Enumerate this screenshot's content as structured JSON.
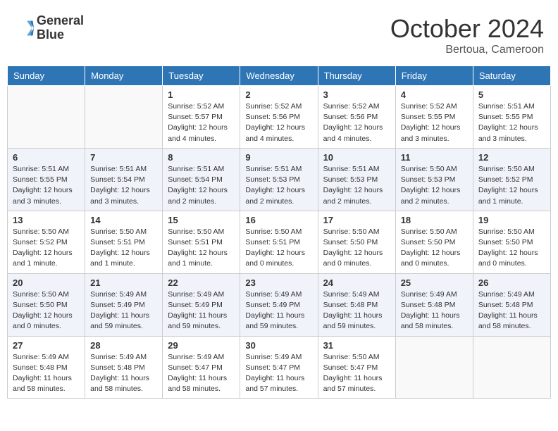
{
  "header": {
    "logo_line1": "General",
    "logo_line2": "Blue",
    "month_title": "October 2024",
    "location": "Bertoua, Cameroon"
  },
  "weekdays": [
    "Sunday",
    "Monday",
    "Tuesday",
    "Wednesday",
    "Thursday",
    "Friday",
    "Saturday"
  ],
  "weeks": [
    [
      {
        "day": "",
        "info": ""
      },
      {
        "day": "",
        "info": ""
      },
      {
        "day": "1",
        "info": "Sunrise: 5:52 AM\nSunset: 5:57 PM\nDaylight: 12 hours\nand 4 minutes."
      },
      {
        "day": "2",
        "info": "Sunrise: 5:52 AM\nSunset: 5:56 PM\nDaylight: 12 hours\nand 4 minutes."
      },
      {
        "day": "3",
        "info": "Sunrise: 5:52 AM\nSunset: 5:56 PM\nDaylight: 12 hours\nand 4 minutes."
      },
      {
        "day": "4",
        "info": "Sunrise: 5:52 AM\nSunset: 5:55 PM\nDaylight: 12 hours\nand 3 minutes."
      },
      {
        "day": "5",
        "info": "Sunrise: 5:51 AM\nSunset: 5:55 PM\nDaylight: 12 hours\nand 3 minutes."
      }
    ],
    [
      {
        "day": "6",
        "info": "Sunrise: 5:51 AM\nSunset: 5:55 PM\nDaylight: 12 hours\nand 3 minutes."
      },
      {
        "day": "7",
        "info": "Sunrise: 5:51 AM\nSunset: 5:54 PM\nDaylight: 12 hours\nand 3 minutes."
      },
      {
        "day": "8",
        "info": "Sunrise: 5:51 AM\nSunset: 5:54 PM\nDaylight: 12 hours\nand 2 minutes."
      },
      {
        "day": "9",
        "info": "Sunrise: 5:51 AM\nSunset: 5:53 PM\nDaylight: 12 hours\nand 2 minutes."
      },
      {
        "day": "10",
        "info": "Sunrise: 5:51 AM\nSunset: 5:53 PM\nDaylight: 12 hours\nand 2 minutes."
      },
      {
        "day": "11",
        "info": "Sunrise: 5:50 AM\nSunset: 5:53 PM\nDaylight: 12 hours\nand 2 minutes."
      },
      {
        "day": "12",
        "info": "Sunrise: 5:50 AM\nSunset: 5:52 PM\nDaylight: 12 hours\nand 1 minute."
      }
    ],
    [
      {
        "day": "13",
        "info": "Sunrise: 5:50 AM\nSunset: 5:52 PM\nDaylight: 12 hours\nand 1 minute."
      },
      {
        "day": "14",
        "info": "Sunrise: 5:50 AM\nSunset: 5:51 PM\nDaylight: 12 hours\nand 1 minute."
      },
      {
        "day": "15",
        "info": "Sunrise: 5:50 AM\nSunset: 5:51 PM\nDaylight: 12 hours\nand 1 minute."
      },
      {
        "day": "16",
        "info": "Sunrise: 5:50 AM\nSunset: 5:51 PM\nDaylight: 12 hours\nand 0 minutes."
      },
      {
        "day": "17",
        "info": "Sunrise: 5:50 AM\nSunset: 5:50 PM\nDaylight: 12 hours\nand 0 minutes."
      },
      {
        "day": "18",
        "info": "Sunrise: 5:50 AM\nSunset: 5:50 PM\nDaylight: 12 hours\nand 0 minutes."
      },
      {
        "day": "19",
        "info": "Sunrise: 5:50 AM\nSunset: 5:50 PM\nDaylight: 12 hours\nand 0 minutes."
      }
    ],
    [
      {
        "day": "20",
        "info": "Sunrise: 5:50 AM\nSunset: 5:50 PM\nDaylight: 12 hours\nand 0 minutes."
      },
      {
        "day": "21",
        "info": "Sunrise: 5:49 AM\nSunset: 5:49 PM\nDaylight: 11 hours\nand 59 minutes."
      },
      {
        "day": "22",
        "info": "Sunrise: 5:49 AM\nSunset: 5:49 PM\nDaylight: 11 hours\nand 59 minutes."
      },
      {
        "day": "23",
        "info": "Sunrise: 5:49 AM\nSunset: 5:49 PM\nDaylight: 11 hours\nand 59 minutes."
      },
      {
        "day": "24",
        "info": "Sunrise: 5:49 AM\nSunset: 5:48 PM\nDaylight: 11 hours\nand 59 minutes."
      },
      {
        "day": "25",
        "info": "Sunrise: 5:49 AM\nSunset: 5:48 PM\nDaylight: 11 hours\nand 58 minutes."
      },
      {
        "day": "26",
        "info": "Sunrise: 5:49 AM\nSunset: 5:48 PM\nDaylight: 11 hours\nand 58 minutes."
      }
    ],
    [
      {
        "day": "27",
        "info": "Sunrise: 5:49 AM\nSunset: 5:48 PM\nDaylight: 11 hours\nand 58 minutes."
      },
      {
        "day": "28",
        "info": "Sunrise: 5:49 AM\nSunset: 5:48 PM\nDaylight: 11 hours\nand 58 minutes."
      },
      {
        "day": "29",
        "info": "Sunrise: 5:49 AM\nSunset: 5:47 PM\nDaylight: 11 hours\nand 58 minutes."
      },
      {
        "day": "30",
        "info": "Sunrise: 5:49 AM\nSunset: 5:47 PM\nDaylight: 11 hours\nand 57 minutes."
      },
      {
        "day": "31",
        "info": "Sunrise: 5:50 AM\nSunset: 5:47 PM\nDaylight: 11 hours\nand 57 minutes."
      },
      {
        "day": "",
        "info": ""
      },
      {
        "day": "",
        "info": ""
      }
    ]
  ]
}
